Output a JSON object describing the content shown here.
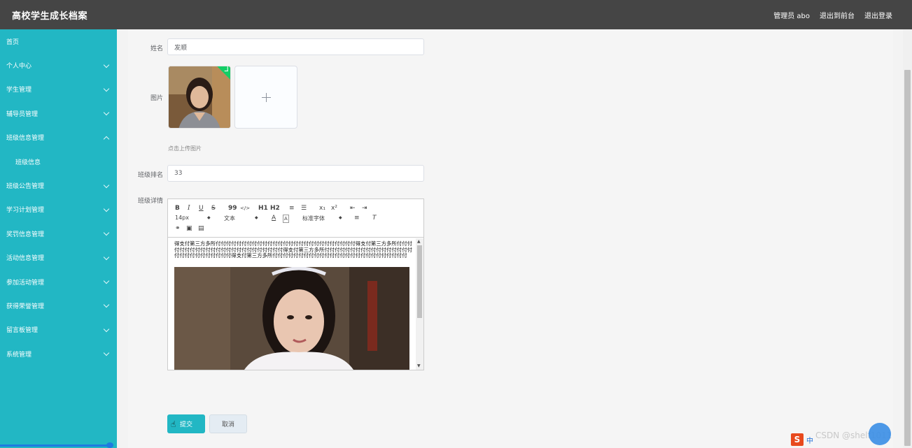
{
  "header": {
    "title": "高校学生成长档案",
    "admin": "管理员 abo",
    "back_to_front": "退出到前台",
    "logout": "退出登录"
  },
  "sidebar": {
    "items": [
      {
        "label": "首页",
        "chevron": "none"
      },
      {
        "label": "个人中心",
        "chevron": "down"
      },
      {
        "label": "学生管理",
        "chevron": "down"
      },
      {
        "label": "辅导员管理",
        "chevron": "down"
      },
      {
        "label": "班级信息管理",
        "chevron": "up"
      },
      {
        "label": "班级信息",
        "chevron": "none",
        "sub": true
      },
      {
        "label": "班级公告管理",
        "chevron": "down"
      },
      {
        "label": "学习计划管理",
        "chevron": "down"
      },
      {
        "label": "奖罚信息管理",
        "chevron": "down"
      },
      {
        "label": "活动信息管理",
        "chevron": "down"
      },
      {
        "label": "参加活动管理",
        "chevron": "down"
      },
      {
        "label": "获得荣誉管理",
        "chevron": "down"
      },
      {
        "label": "留言板管理",
        "chevron": "down"
      },
      {
        "label": "系统管理",
        "chevron": "down"
      }
    ]
  },
  "form": {
    "name_label": "姓名",
    "name_value": "发顺",
    "image_label": "图片",
    "upload_hint": "点击上传图片",
    "rank_label": "班级排名",
    "rank_value": "33",
    "detail_label": "班级详情",
    "submit": "提交",
    "cancel": "取消"
  },
  "editor": {
    "toolbar": {
      "bold": "B",
      "italic": "I",
      "underline": "U",
      "strike": "S",
      "quote": "99",
      "code": "</>",
      "h1": "H1",
      "h2": "H2",
      "sub": "x₁",
      "sup": "x²",
      "size": "14px",
      "text": "文本",
      "font": "标准字体"
    },
    "content": "得支付第三方多所付付付付付付付付付付付付付付付付付付付付付付付付付付付得支付第三方多所付付付付付付付付付付付付付付付付付付付付付付付付得支付第三方多所付付付付付付付付付付付付付付付付付付付付付付付付付付付付得支付第三方多所付付付付付付付付付付付付付付付付付付付付付付付付付付"
  },
  "tray": {
    "ime": "中",
    "watermark": "CSDN @shelf1011"
  },
  "colors": {
    "accent": "#22b7c4",
    "header": "#454545",
    "success": "#13ce66"
  }
}
